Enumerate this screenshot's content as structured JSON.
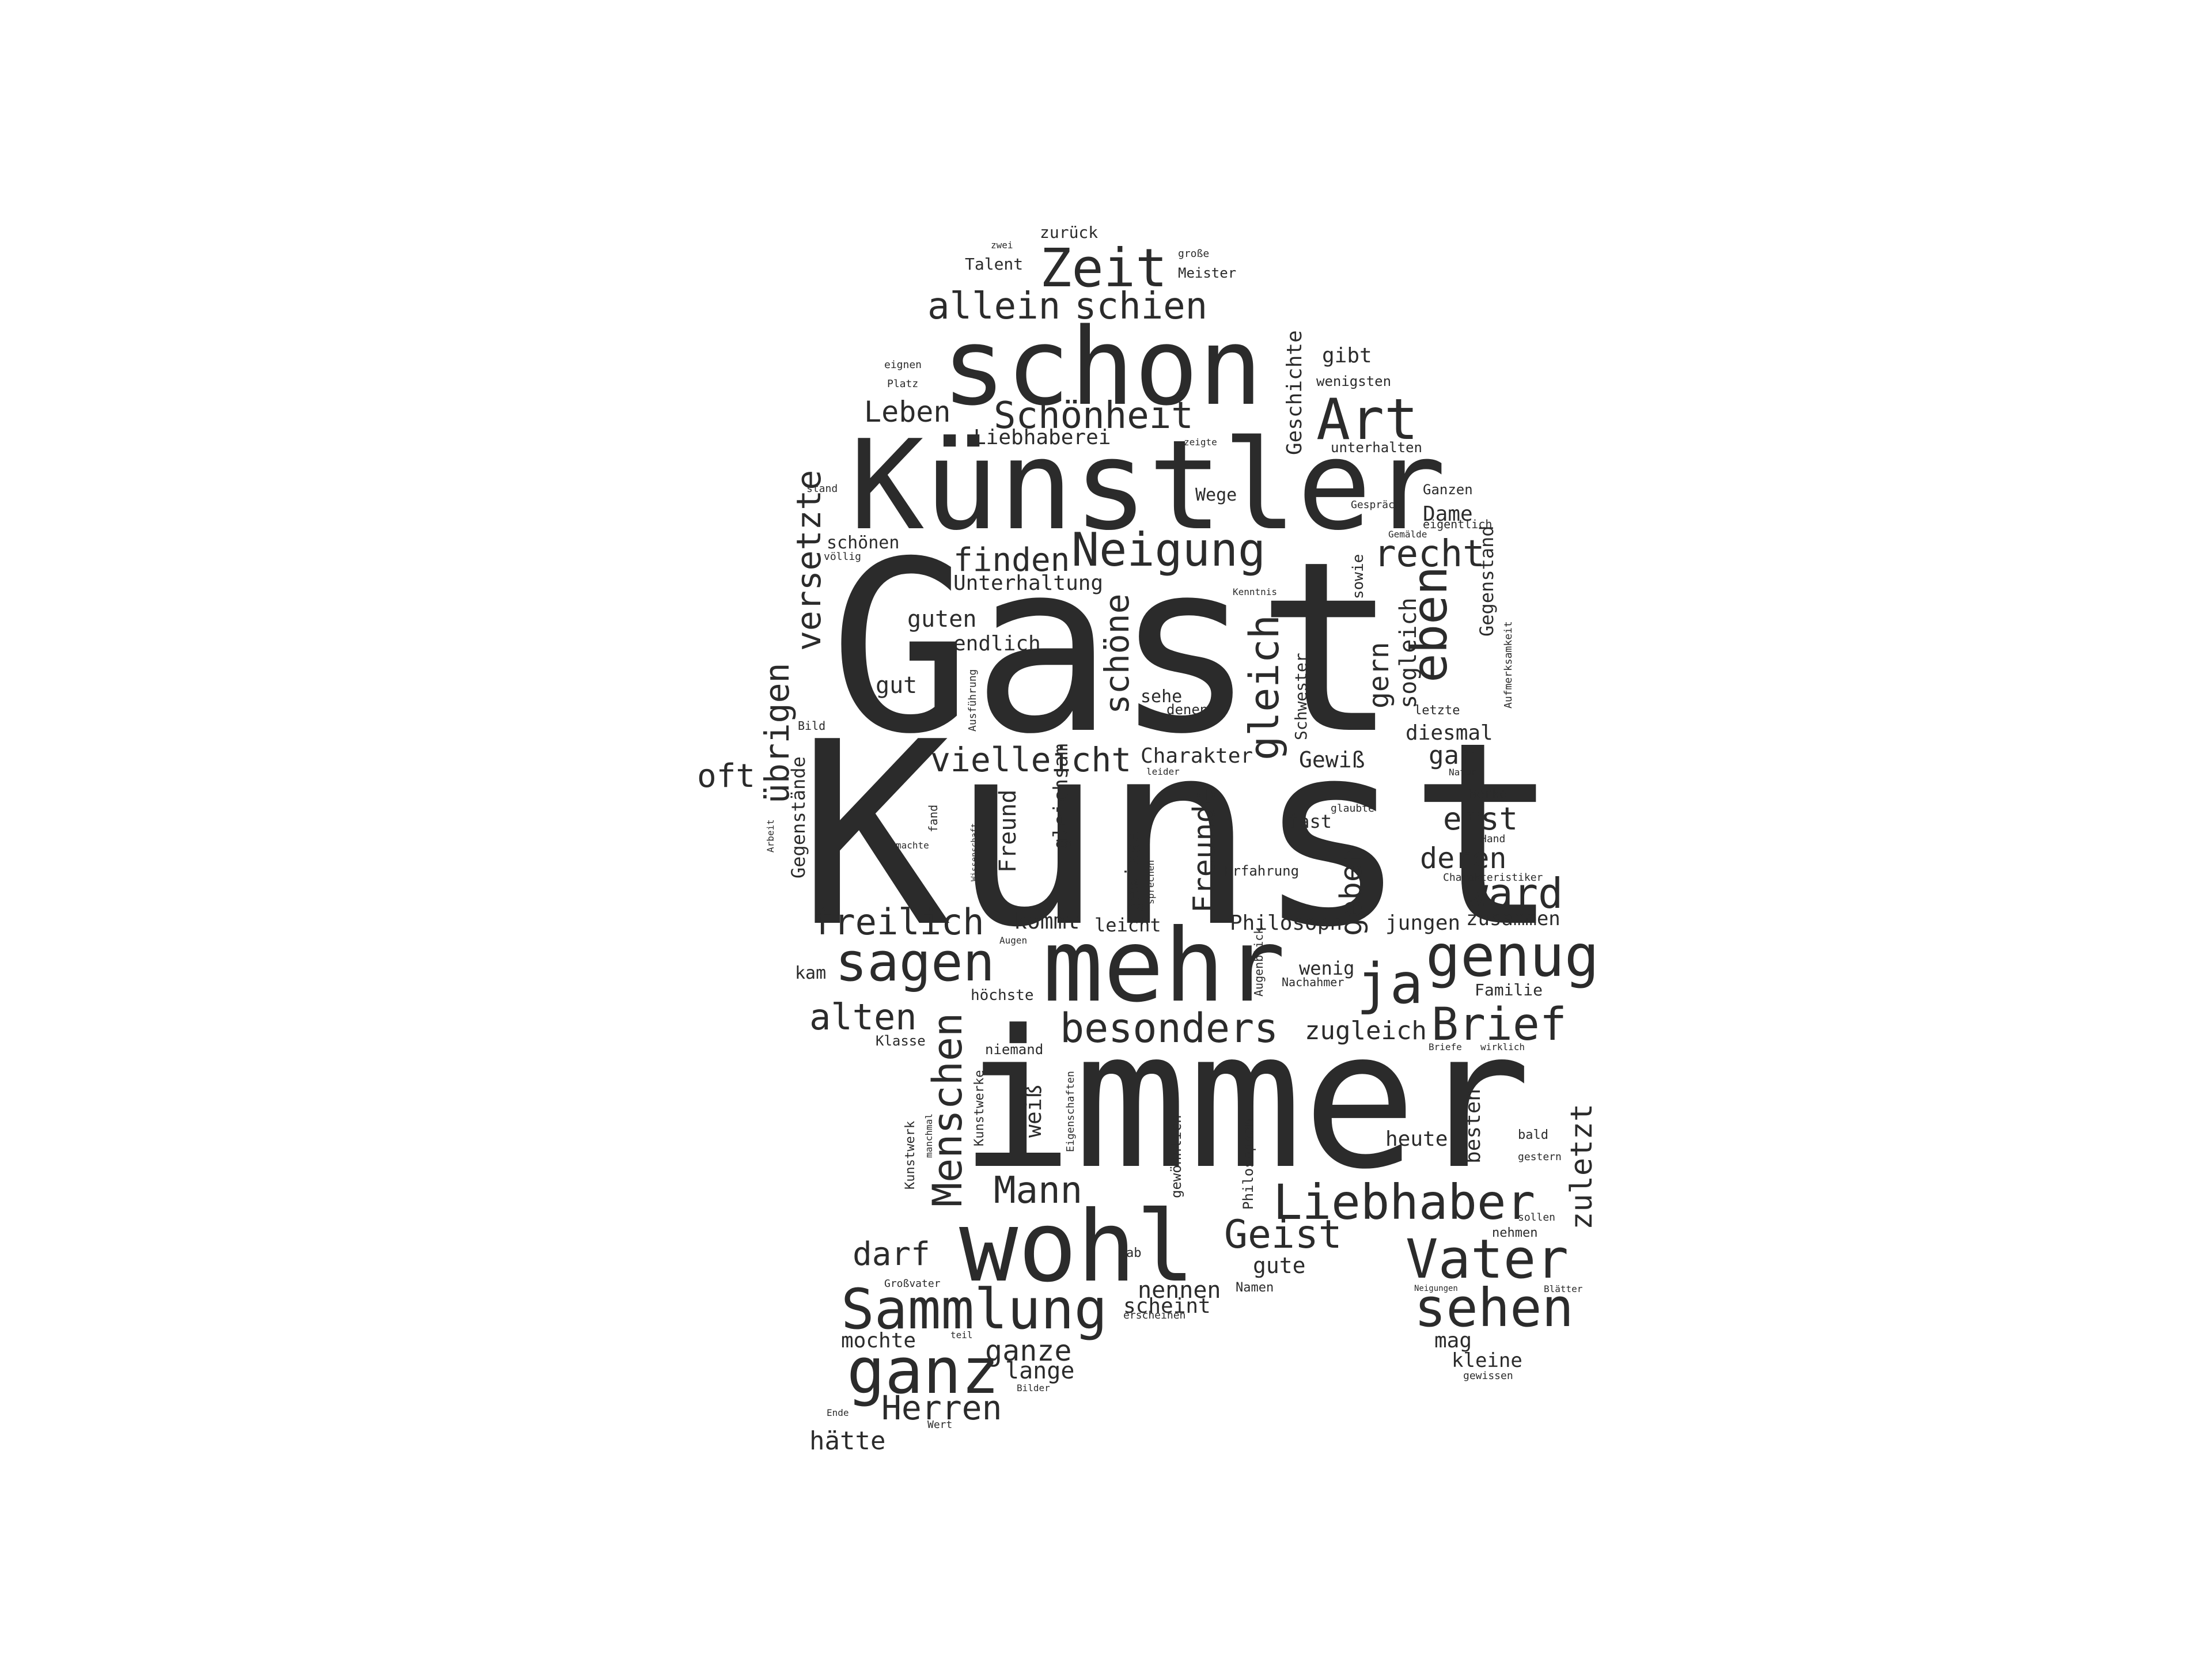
{
  "text_color": "#2b2b2b",
  "background": "#ffffff",
  "words": [
    "Kunst",
    "Gast",
    "immer",
    "Künstler",
    "schon",
    "mehr",
    "wohl",
    "Zeit",
    "allein",
    "schien",
    "Schönheit",
    "Art",
    "Leben",
    "Liebhaberei",
    "Neigung",
    "recht",
    "finden",
    "eben",
    "Unterhaltung",
    "versetzte",
    "guten",
    "endlich",
    "schöne",
    "gleich",
    "gern",
    "sogleich",
    "gut",
    "übrigen",
    "oft",
    "vielleicht",
    "Charakter",
    "Gewiß",
    "gar",
    "diesmal",
    "Freunde",
    "geben",
    "erst",
    "deren",
    "ward",
    "freilich",
    "kommt",
    "leicht",
    "Philosoph",
    "jungen",
    "zusammen",
    "sagen",
    "genug",
    "ja",
    "alten",
    "besonders",
    "zugleich",
    "Brief",
    "Menschen",
    "Mann",
    "Liebhaber",
    "Vater",
    "Geist",
    "gute",
    "darf",
    "Sammlung",
    "sehen",
    "ganz",
    "ganze",
    "lange",
    "Herren",
    "hätte",
    "mochte",
    "nennen",
    "scheint",
    "mag",
    "kleine",
    "zuletzt",
    "besten",
    "heute",
    "weiß",
    "Gegenstände",
    "Freund",
    "gleichsam",
    "gewisse",
    "fast",
    "Geschichte",
    "gibt",
    "wenigsten",
    "Dame",
    "Talent",
    "zurück",
    "Meister",
    "große",
    "Wege",
    "sowie",
    "Gegenstand",
    "Schwester",
    "sehe",
    "denen",
    "Erfahrung",
    "wenig",
    "Familie",
    "schönen",
    "völlig",
    "Platz",
    "eignen",
    "unterhalten",
    "Ganzen",
    "eigentlich",
    "stand",
    "Bild",
    "Werke",
    "Hand",
    "zwei",
    "kam",
    "Klasse",
    "niemand",
    "Kunstwerke",
    "Kunstwerk",
    "manchmal",
    "höchste",
    "Augen",
    "Eigenschaften",
    "Aufmerksamkeit",
    "Ausführung",
    "Nachahmer",
    "Augenblick",
    "Philosophen",
    "gewöhnlich",
    "Wert",
    "Ende",
    "Großvater",
    "erscheinen",
    "Namen",
    "sollen",
    "bald",
    "gestern",
    "nehmen",
    "Neigungen",
    "Blätter",
    "gewissen",
    "Gespräch",
    "letzte",
    "Natur",
    "glaubte",
    "Charakteristiker",
    "zeigte",
    "Kenntnis",
    "ab",
    "teil",
    "Bilder",
    "leider",
    "fand",
    "machte",
    "Arbeit",
    "Wissenschaft",
    "sprechen",
    "wirklich",
    "Briefe",
    "Gemälde"
  ]
}
